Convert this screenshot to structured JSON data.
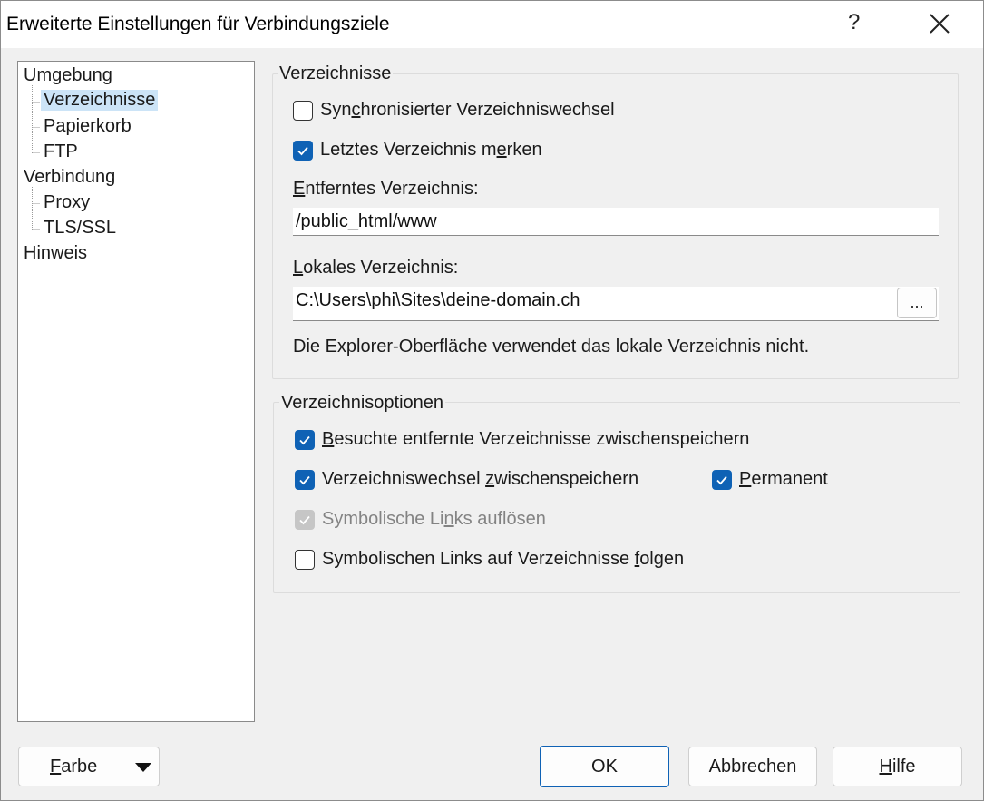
{
  "window": {
    "title": "Erweiterte Einstellungen für Verbindungsziele"
  },
  "titlebar": {
    "help_label": "?",
    "close_icon": "close-icon"
  },
  "tree": {
    "items": [
      {
        "label": "Umgebung",
        "level": 0
      },
      {
        "label": "Verzeichnisse",
        "level": 1,
        "selected": true
      },
      {
        "label": "Papierkorb",
        "level": 1
      },
      {
        "label": "FTP",
        "level": 1
      },
      {
        "label": "Verbindung",
        "level": 0
      },
      {
        "label": "Proxy",
        "level": 1
      },
      {
        "label": "TLS/SSL",
        "level": 1
      },
      {
        "label": "Hinweis",
        "level": 0
      }
    ]
  },
  "directories": {
    "group_title": "Verzeichnisse",
    "sync_label_pre": "Syn",
    "sync_label_mn": "c",
    "sync_label_post": "hronisierter Verzeichniswechsel",
    "sync_checked": false,
    "remember_label_pre": "Letztes Verzeichnis m",
    "remember_label_mn": "e",
    "remember_label_post": "rken",
    "remember_checked": true,
    "remote_label_mn": "E",
    "remote_label_post": "ntferntes Verzeichnis:",
    "remote_value": "/public_html/www",
    "local_label_mn": "L",
    "local_label_post": "okales Verzeichnis:",
    "local_value": "C:\\Users\\phi\\Sites\\deine-domain.ch",
    "browse_label": "...",
    "note": "Die Explorer-Oberfläche verwendet das lokale Verzeichnis nicht."
  },
  "options": {
    "group_title": "Verzeichnisoptionen",
    "cache_visited_mn": "B",
    "cache_visited_post": "esuchte entfernte Verzeichnisse zwischenspeichern",
    "cache_visited_checked": true,
    "cache_changes_pre": "Verzeichniswechsel ",
    "cache_changes_mn": "z",
    "cache_changes_post": "wischenspeichern",
    "cache_changes_checked": true,
    "permanent_mn": "P",
    "permanent_post": "ermanent",
    "permanent_checked": true,
    "resolve_symlinks_pre": "Symbolische Li",
    "resolve_symlinks_mn": "n",
    "resolve_symlinks_post": "ks auflösen",
    "resolve_symlinks_checked": true,
    "resolve_symlinks_disabled": true,
    "follow_symlinks_pre": "Symbolischen Links auf Verzeichnisse ",
    "follow_symlinks_mn": "f",
    "follow_symlinks_post": "olgen",
    "follow_symlinks_checked": false
  },
  "buttons": {
    "color_mn": "F",
    "color_post": "arbe",
    "ok": "OK",
    "cancel": "Abbrechen",
    "help_mn": "H",
    "help_post": "ilfe"
  },
  "colors": {
    "accent": "#0f62b5",
    "selection": "#cce4f7"
  }
}
